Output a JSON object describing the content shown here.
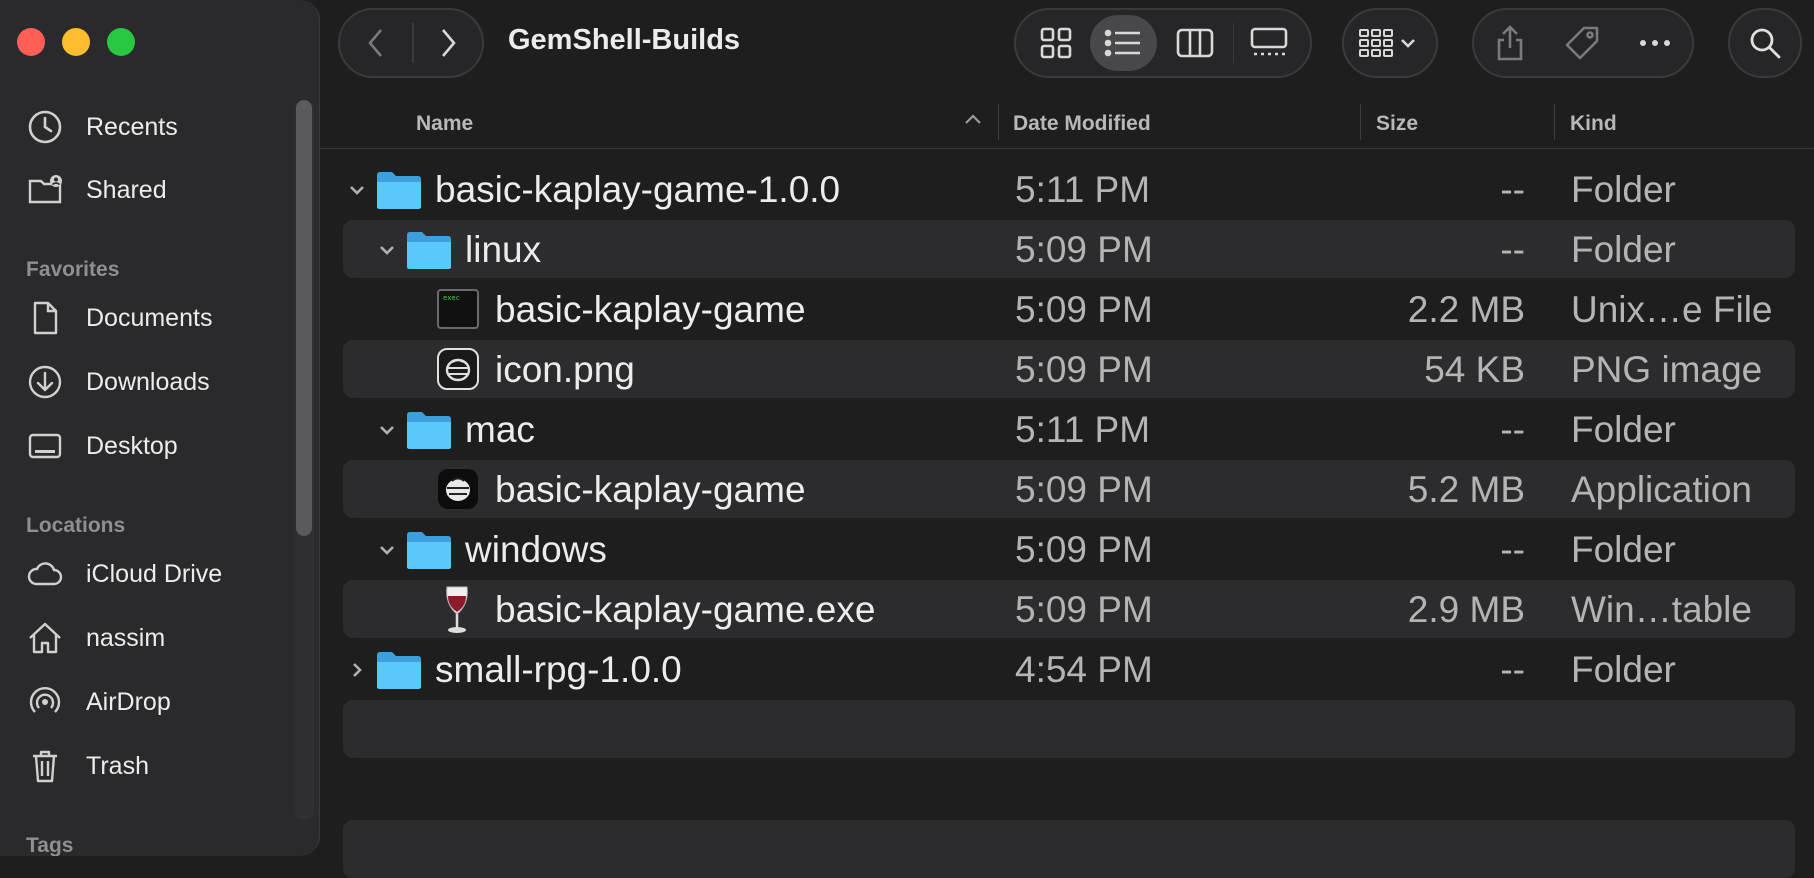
{
  "window": {
    "title": "GemShell-Builds"
  },
  "sidebar": {
    "items_top": [
      {
        "label": "Recents",
        "icon": "clock-icon"
      },
      {
        "label": "Shared",
        "icon": "shared-folder-icon"
      }
    ],
    "favorites_label": "Favorites",
    "favorites": [
      {
        "label": "Documents",
        "icon": "document-icon"
      },
      {
        "label": "Downloads",
        "icon": "download-icon"
      },
      {
        "label": "Desktop",
        "icon": "desktop-icon"
      }
    ],
    "locations_label": "Locations",
    "locations": [
      {
        "label": "iCloud Drive",
        "icon": "cloud-icon"
      },
      {
        "label": "nassim",
        "icon": "home-icon"
      },
      {
        "label": "AirDrop",
        "icon": "airdrop-icon"
      },
      {
        "label": "Trash",
        "icon": "trash-icon"
      }
    ],
    "tags_label": "Tags"
  },
  "columns": {
    "name": "Name",
    "date": "Date Modified",
    "size": "Size",
    "kind": "Kind"
  },
  "rows": [
    {
      "name": "basic-kaplay-game-1.0.0",
      "date": "5:11 PM",
      "size": "--",
      "kind": "Folder",
      "icon": "folder-icon",
      "expanded": true
    },
    {
      "name": "linux",
      "date": "5:09 PM",
      "size": "--",
      "kind": "Folder",
      "icon": "folder-icon",
      "expanded": true
    },
    {
      "name": "basic-kaplay-game",
      "date": "5:09 PM",
      "size": "2.2 MB",
      "kind": "Unix…e File",
      "icon": "terminal-exec-icon",
      "exec_label": "exec"
    },
    {
      "name": "icon.png",
      "date": "5:09 PM",
      "size": "54 KB",
      "kind": "PNG image",
      "icon": "png-image-icon"
    },
    {
      "name": "mac",
      "date": "5:11 PM",
      "size": "--",
      "kind": "Folder",
      "icon": "folder-icon",
      "expanded": true
    },
    {
      "name": "basic-kaplay-game",
      "date": "5:09 PM",
      "size": "5.2 MB",
      "kind": "Application",
      "icon": "app-icon"
    },
    {
      "name": "windows",
      "date": "5:09 PM",
      "size": "--",
      "kind": "Folder",
      "icon": "folder-icon",
      "expanded": true
    },
    {
      "name": "basic-kaplay-game.exe",
      "date": "5:09 PM",
      "size": "2.9 MB",
      "kind": "Win…table",
      "icon": "wine-glass-icon"
    },
    {
      "name": "small-rpg-1.0.0",
      "date": "4:54 PM",
      "size": "--",
      "kind": "Folder",
      "icon": "folder-icon",
      "expanded": false
    }
  ],
  "colors": {
    "accent_folder": "#5ac8fa",
    "background": "#1e1e1f",
    "sidebar": "#2a2a2c"
  }
}
